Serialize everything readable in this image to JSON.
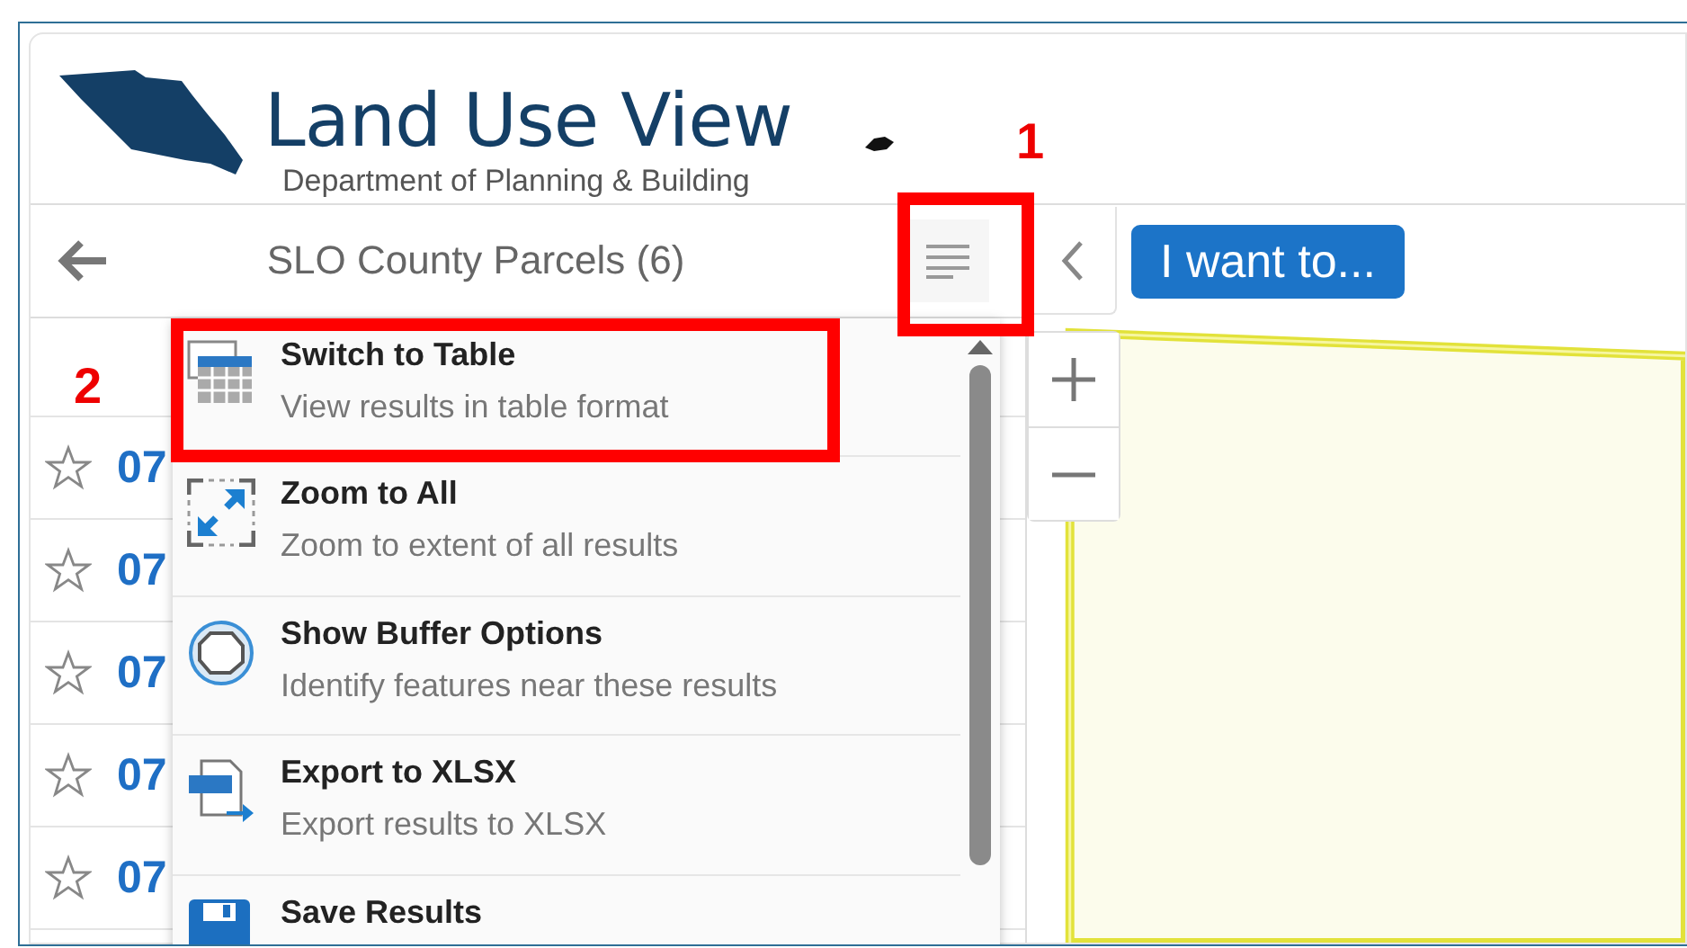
{
  "header": {
    "title": "Land Use View",
    "subtitle": "Department of Planning & Building"
  },
  "results_panel": {
    "title": "SLO County Parcels (6)",
    "rows": [
      {
        "label": "07",
        "starred": false
      },
      {
        "label": "07",
        "starred": false
      },
      {
        "label": "07",
        "starred": false
      },
      {
        "label": "07",
        "starred": false
      },
      {
        "label": "07",
        "starred": false
      }
    ]
  },
  "actions_menu": {
    "items": [
      {
        "kind": "table",
        "title": "Switch to Table",
        "description": "View results in table format"
      },
      {
        "kind": "zoom",
        "title": "Zoom to All",
        "description": "Zoom to extent of all results"
      },
      {
        "kind": "buffer",
        "title": "Show Buffer Options",
        "description": "Identify features near these results"
      },
      {
        "kind": "export",
        "title": "Export to XLSX",
        "description": "Export results to XLSX"
      },
      {
        "kind": "save",
        "title": "Save Results"
      }
    ]
  },
  "map": {
    "button": "I want to..."
  },
  "annotations": [
    {
      "label": "1"
    },
    {
      "label": "2"
    }
  ]
}
